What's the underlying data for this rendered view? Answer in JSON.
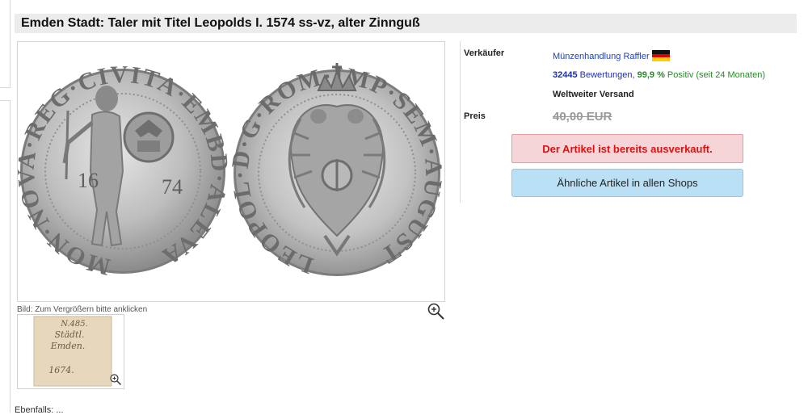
{
  "title": "Emden Stadt: Taler mit Titel Leopolds I. 1574 ss-vz, alter Zinnguß",
  "image": {
    "caption": "Bild: Zum Vergrößern bitte anklicken",
    "obverse_legend": "MON·NOVA·REG·CIVITA·EMBD·ALEVA",
    "obverse_year_left": "16",
    "obverse_year_right": "74",
    "reverse_legend": "LEOPOL·D·G·ROM·IMP·SEM·AUGUST"
  },
  "thumbnail": {
    "note_lines": [
      "N.485.",
      "Städtl.",
      "Emden.",
      "1674."
    ]
  },
  "info": {
    "seller_label": "Verkäufer",
    "seller_name": "Münzenhandlung Raffler",
    "ratings_count": "32445",
    "ratings_word": "Bewertungen,",
    "ratings_percent": "99,9 %",
    "ratings_rest": "Positiv (seit 24 Monaten)",
    "shipping": "Weltweiter Versand",
    "price_label": "Preis",
    "price": "40,00 EUR",
    "sold_out": "Der Artikel ist bereits ausverkauft.",
    "similar_button": "Ähnliche Artikel in allen Shops"
  },
  "bottom_text": "Ebenfalls: ...",
  "colors": {
    "sold_text": "#e01010",
    "sold_bg": "#f5d5d7",
    "similar_bg": "#b9e0f4",
    "link_blue": "#1a2fb5",
    "positive_green": "#2a8a2a"
  },
  "icons": {
    "zoom": "magnifier-plus-icon",
    "flag": "germany-flag-icon"
  }
}
